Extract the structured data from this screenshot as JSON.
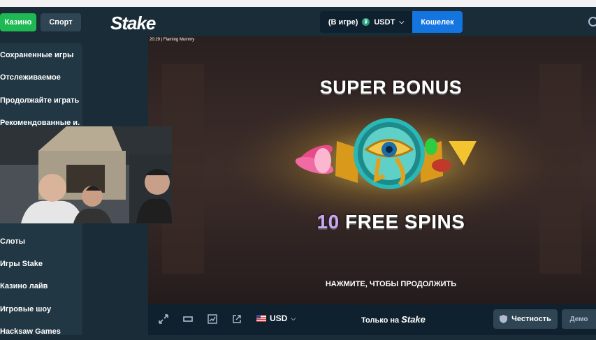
{
  "header": {
    "tab_casino": "Казино",
    "tab_sport": "Спорт",
    "logo": "Stake",
    "wallet_status": "(В игре)",
    "currency": "USDT",
    "wallet_button": "Кошелек"
  },
  "sidebar": {
    "items": [
      {
        "label": "Сохраненные игры"
      },
      {
        "label": "Отслеживаемое"
      },
      {
        "label": "Продолжайте играть"
      },
      {
        "label": "Рекомендованные и..."
      },
      {
        "label": "Слоты"
      },
      {
        "label": "Игры Stake"
      },
      {
        "label": "Казино лайв"
      },
      {
        "label": "Игровые шоу"
      },
      {
        "label": "Hacksaw Games"
      }
    ]
  },
  "game": {
    "caption": "20:29 | Flaming Mummy",
    "bonus_title": "SUPER BONUS",
    "free_spins_count": "10",
    "free_spins_text": "FREE SPINS",
    "continue_text": "НАЖМИТЕ, ЧТОБЫ ПРОДОЛЖИТЬ"
  },
  "toolbar": {
    "currency": "USD",
    "only_on": "Только на",
    "only_on_brand": "Stake",
    "fairness": "Честность",
    "demo": "Демо"
  },
  "colors": {
    "accent_green": "#1fb954",
    "wallet_blue": "#1475e1",
    "bg": "#1a2c38"
  }
}
